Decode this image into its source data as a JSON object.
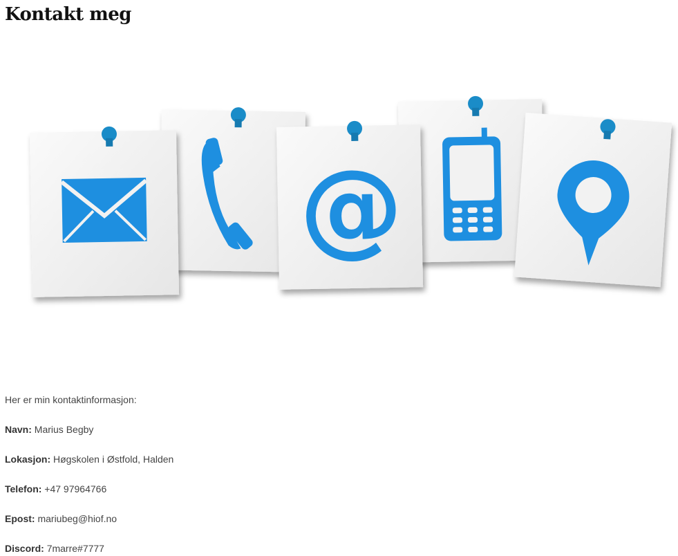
{
  "page": {
    "title": "Kontakt meg"
  },
  "hero": {
    "icons": [
      "envelope-icon",
      "phone-icon",
      "at-sign-icon",
      "mobile-phone-icon",
      "location-pin-icon"
    ],
    "accent": "#1e8fe0"
  },
  "contact": {
    "intro": "Her er min kontaktinformasjon:",
    "rows": [
      {
        "label": "Navn:",
        "value": "Marius Begby"
      },
      {
        "label": "Lokasjon:",
        "value": "Høgskolen i Østfold, Halden"
      },
      {
        "label": "Telefon:",
        "value": "+47 97964766"
      },
      {
        "label": "Epost:",
        "value": "mariubeg@hiof.no"
      },
      {
        "label": "Discord:",
        "value": "7marre#7777"
      }
    ]
  }
}
